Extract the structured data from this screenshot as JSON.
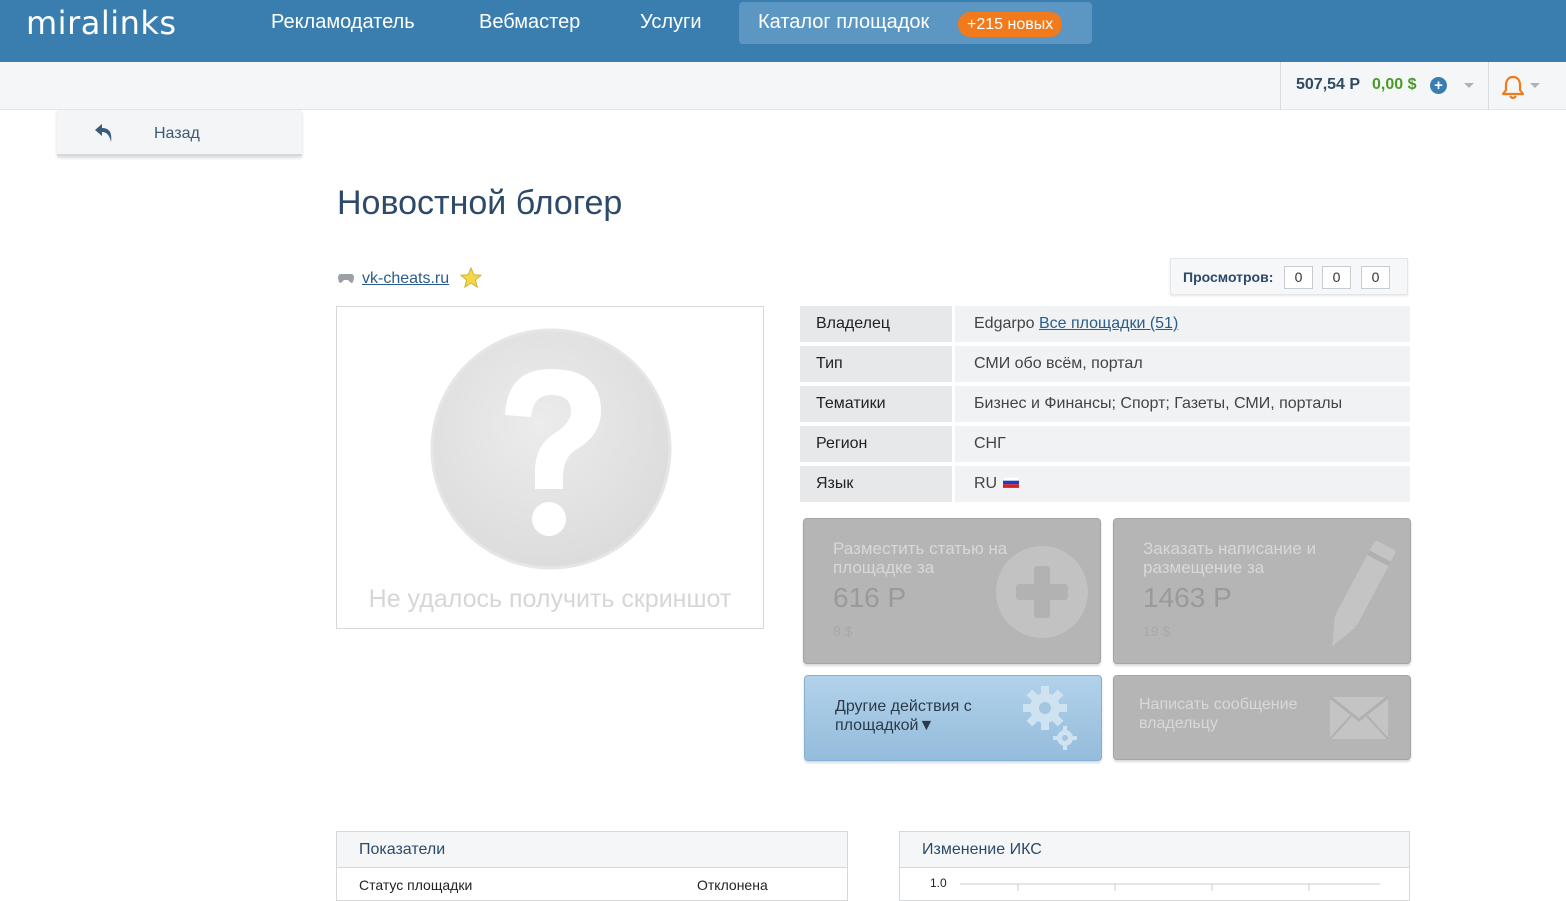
{
  "header": {
    "logo": "miralinks",
    "nav": [
      {
        "label": "Рекламодатель"
      },
      {
        "label": "Вебмастер"
      },
      {
        "label": "Услуги"
      },
      {
        "label": "Каталог площадок",
        "badge": "+215 новых"
      }
    ]
  },
  "account": {
    "balance_rub": "507,54 Р",
    "balance_usd": "0,00 $"
  },
  "back": {
    "label": "Назад"
  },
  "page_title": "Новостной блогер",
  "site": {
    "domain": "vk-cheats.ru"
  },
  "views": {
    "label": "Просмотров:",
    "values": [
      "0",
      "0",
      "0"
    ]
  },
  "screenshot": {
    "caption": "Не удалось получить скриншот"
  },
  "info": [
    {
      "key": "Владелец",
      "value": "Edgarpo",
      "link": "Все площадки (51)"
    },
    {
      "key": "Тип",
      "value": "СМИ обо всём, портал"
    },
    {
      "key": "Тематики",
      "value": "Бизнес и Финансы; Спорт; Газеты, СМИ, порталы"
    },
    {
      "key": "Регион",
      "value": "СНГ"
    },
    {
      "key": "Язык",
      "value": "RU"
    }
  ],
  "actions": {
    "place": {
      "title": "Разместить статью на площадке за",
      "price": "616 Р",
      "usd": "8 $"
    },
    "order": {
      "title": "Заказать написание и размещение за",
      "price": "1463 Р",
      "usd": "19 $"
    },
    "other": {
      "label": "Другие действия с площадкой▼"
    },
    "message": {
      "label": "Написать сообщение владельцу"
    }
  },
  "panels": {
    "metrics": {
      "title": "Показатели",
      "row_label": "Статус площадки",
      "row_value": "Отклонена"
    },
    "iks": {
      "title": "Изменение ИКС",
      "axis_top": "1.0"
    }
  },
  "colors": {
    "header_bg": "#3a7eb0",
    "badge": "#f07a1c",
    "usd_balance": "#4a9a2a",
    "bell": "#f07a1c"
  }
}
